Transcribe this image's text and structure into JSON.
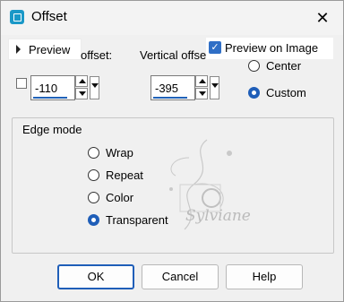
{
  "window": {
    "title": "Offset",
    "close_glyph": "✕"
  },
  "preview": {
    "label": "Preview"
  },
  "preview_on_image": {
    "label": "Preview on Image",
    "checked": true
  },
  "horizontal": {
    "label": "offset:",
    "value": "-110"
  },
  "vertical": {
    "label": "Vertical offse",
    "value": "-395"
  },
  "offset_mode": {
    "options": [
      "Center",
      "Custom"
    ],
    "selected": "Custom"
  },
  "edge_mode": {
    "title": "Edge mode",
    "options": [
      "Wrap",
      "Repeat",
      "Color",
      "Transparent"
    ],
    "selected": "Transparent"
  },
  "watermark": {
    "text": "Sylviane"
  },
  "buttons": {
    "ok": "OK",
    "cancel": "Cancel",
    "help": "Help"
  },
  "colors": {
    "accent": "#1f5eb8",
    "app_icon": "#1a98c7"
  }
}
